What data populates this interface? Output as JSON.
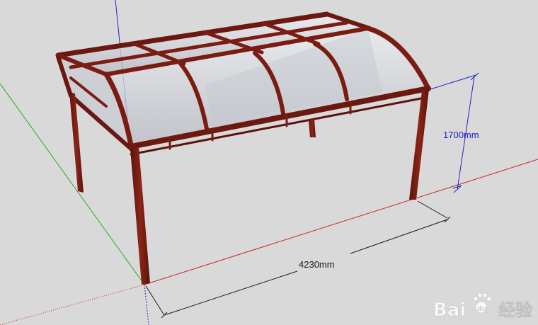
{
  "dimensions": {
    "height_label": "1700mm",
    "width_label": "4230mm"
  },
  "watermark": {
    "brand": "Bai",
    "brand_suffix": "经验",
    "logo": "paw-logo-icon"
  },
  "colors": {
    "background": "#d9d9d9",
    "frame": "#7a1c12",
    "frame_dark": "#4e0f09",
    "glass": "#cfd2d8",
    "axis_red": "#cc2222",
    "axis_green": "#22aa22",
    "axis_blue": "#2222cc",
    "dim_line": "#1a1a1a",
    "dim_text_blue": "#1a1acc"
  }
}
